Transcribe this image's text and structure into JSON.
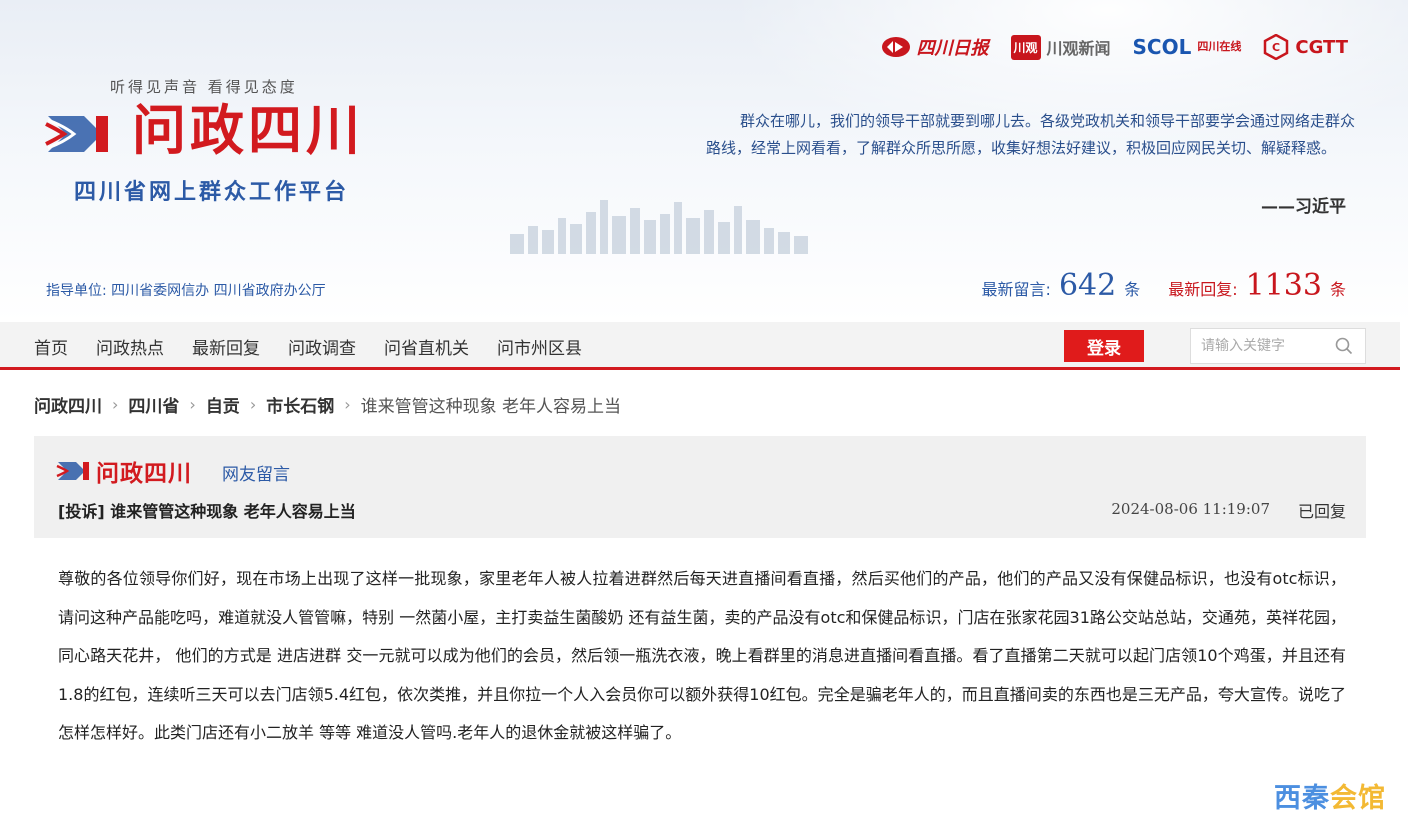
{
  "header": {
    "slogan": "听得见声音  看得见态度",
    "site_title": "问政四川",
    "site_subtitle": "四川省网上群众工作平台",
    "partners": {
      "sichuan_daily": "四川日报",
      "chuanguan_box": "川观",
      "chuanguan_text": "川观新闻",
      "scol": "SCOL",
      "scol_small": "四川在线",
      "cgtt": "CGTT"
    },
    "quote": "群众在哪儿，我们的领导干部就要到哪儿去。各级党政机关和领导干部要学会通过网络走群众路线，经常上网看看，了解群众所思所愿，收集好想法好建议，积极回应网民关切、解疑释惑。",
    "quote_author": "——习近平",
    "guide": "指导单位: 四川省委网信办  四川省政府办公厅",
    "stats": {
      "latest_messages_label": "最新留言:",
      "latest_messages_count": "642",
      "latest_replies_label": "最新回复:",
      "latest_replies_count": "1133",
      "unit": "条"
    }
  },
  "nav": {
    "items": [
      "首页",
      "问政热点",
      "最新回复",
      "问政调查",
      "问省直机关",
      "问市州区县"
    ],
    "login_label": "登录",
    "search_placeholder": "请输入关键字"
  },
  "breadcrumb": {
    "items": [
      "问政四川",
      "四川省",
      "自贡",
      "市长石钢"
    ],
    "current": "谁来管管这种现象 老年人容易上当"
  },
  "message": {
    "brand": "问政四川",
    "section": "网友留言",
    "title": "[投诉] 谁来管管这种现象 老年人容易上当",
    "datetime": "2024-08-06 11:19:07",
    "status": "已回复",
    "body": "尊敬的各位领导你们好，现在市场上出现了这样一批现象，家里老年人被人拉着进群然后每天进直播间看直播，然后买他们的产品，他们的产品又没有保健品标识，也没有otc标识，请问这种产品能吃吗，难道就没人管管嘛，特别 一然菌小屋，主打卖益生菌酸奶 还有益生菌，卖的产品没有otc和保健品标识，门店在张家花园31路公交站总站，交通苑，英祥花园，同心路天花井， 他们的方式是 进店进群 交一元就可以成为他们的会员，然后领一瓶洗衣液，晚上看群里的消息进直播间看直播。看了直播第二天就可以起门店领10个鸡蛋，并且还有1.8的红包，连续听三天可以去门店领5.4红包，依次类推，并且你拉一个人入会员你可以额外获得10红包。完全是骗老年人的，而且直播间卖的东西也是三无产品，夸大宣传。说吃了怎样怎样好。此类门店还有小二放羊 等等 难道没人管吗.老年人的退休金就被这样骗了。"
  },
  "watermark": {
    "part1": "西秦",
    "part2": "会馆"
  },
  "colors": {
    "brand_red": "#d21a1f",
    "brand_blue": "#2c5aa6",
    "login_red": "#e01b1b"
  }
}
